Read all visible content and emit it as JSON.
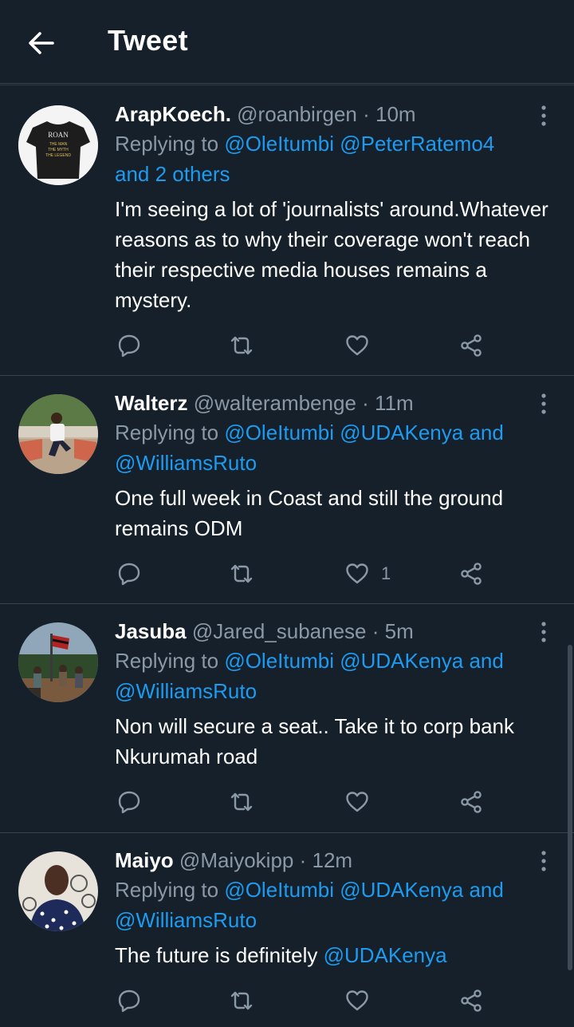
{
  "header": {
    "title": "Tweet",
    "back_icon": "arrow-left-icon"
  },
  "colors": {
    "background": "#15202b",
    "link": "#1d9bf0",
    "secondary_text": "#8b98a5",
    "divider": "#38444d"
  },
  "tweets": [
    {
      "name": "ArapKoech.",
      "handle": "@roanbirgen",
      "dot": "·",
      "time": "10m",
      "replying_prefix": "Replying to ",
      "replying_links": [
        "@OleItumbi",
        "@PeterRatemo4",
        "and 2 others"
      ],
      "replying_sep": " ",
      "text": "I'm seeing a lot of 'journalists' around.Whatever reasons as to why their coverage won't reach their respective media houses remains a mystery.",
      "likes": ""
    },
    {
      "name": "Walterz",
      "handle": "@walterambenge",
      "dot": "·",
      "time": "11m",
      "replying_prefix": "Replying to ",
      "replying_links": [
        "@OleItumbi",
        "@UDAKenya",
        "and",
        "@WilliamsRuto"
      ],
      "text": "One full week in Coast and still the ground remains ODM",
      "likes": "1"
    },
    {
      "name": "Jasuba",
      "handle": "@Jared_subanese",
      "dot": "·",
      "time": "5m",
      "replying_prefix": "Replying to ",
      "replying_links": [
        "@OleItumbi",
        "@UDAKenya",
        "and",
        "@WilliamsRuto"
      ],
      "text": "Non will secure a seat.. Take it to corp bank Nkurumah road",
      "likes": ""
    },
    {
      "name": "Maiyo",
      "handle": "@Maiyokipp",
      "dot": "·",
      "time": "12m",
      "replying_prefix": "Replying to ",
      "replying_links": [
        "@OleItumbi",
        "@UDAKenya",
        "and",
        "@WilliamsRuto"
      ],
      "text_prefix": "The future is definitely ",
      "text_link": "@UDAKenya",
      "likes": ""
    }
  ],
  "avatar_0": {
    "shirt_lines": [
      "ROAN",
      "THE MAN",
      "THE MYTH",
      "THE LEGEND"
    ]
  }
}
